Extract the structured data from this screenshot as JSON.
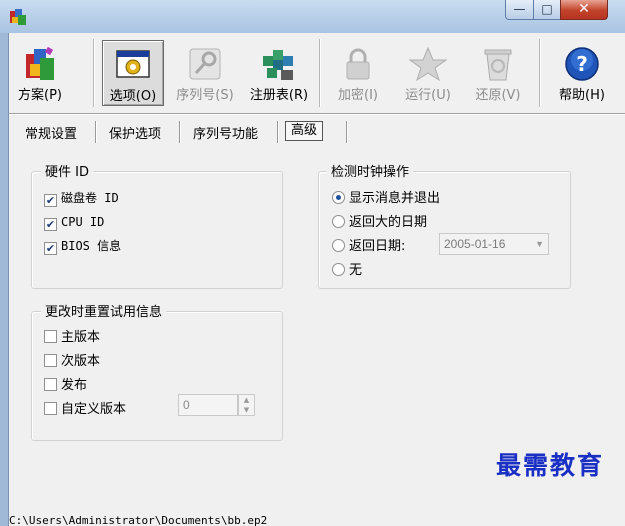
{
  "window": {
    "minimize_glyph": "—",
    "maximize_glyph": "□",
    "close_glyph": "✕"
  },
  "toolbar": {
    "scheme": "方案(P)",
    "options": "选项(O)",
    "serial": "序列号(S)",
    "registry": "注册表(R)",
    "encrypt": "加密(I)",
    "run": "运行(U)",
    "restore": "还原(V)",
    "help": "帮助(H)"
  },
  "tabs": {
    "general": "常规设置",
    "protection": "保护选项",
    "serial_func": "序列号功能",
    "advanced": "高级"
  },
  "hardware": {
    "title": "硬件 ID",
    "items": [
      {
        "label": "磁盘卷 ID",
        "checked": true
      },
      {
        "label": "CPU ID",
        "checked": true
      },
      {
        "label": "BIOS 信息",
        "checked": true
      }
    ]
  },
  "clock": {
    "title": "检测时钟操作",
    "options": [
      {
        "label": "显示消息并退出",
        "selected": true
      },
      {
        "label": "返回大的日期",
        "selected": false
      },
      {
        "label": "返回日期:",
        "selected": false
      },
      {
        "label": "无",
        "selected": false
      }
    ],
    "date_value": "2005-01-16"
  },
  "reset": {
    "title": "更改时重置试用信息",
    "items": [
      {
        "label": "主版本",
        "checked": false
      },
      {
        "label": "次版本",
        "checked": false
      },
      {
        "label": "发布",
        "checked": false
      },
      {
        "label": "自定义版本",
        "checked": false
      }
    ],
    "custom_value": "0"
  },
  "status": {
    "path": "C:\\Users\\Administrator\\Documents\\bb.ep2"
  },
  "watermark": {
    "text": "最需教育"
  },
  "colors": {
    "accent": "#23509a",
    "close_red": "#c2432b",
    "watermark": "#1a2fc4"
  }
}
